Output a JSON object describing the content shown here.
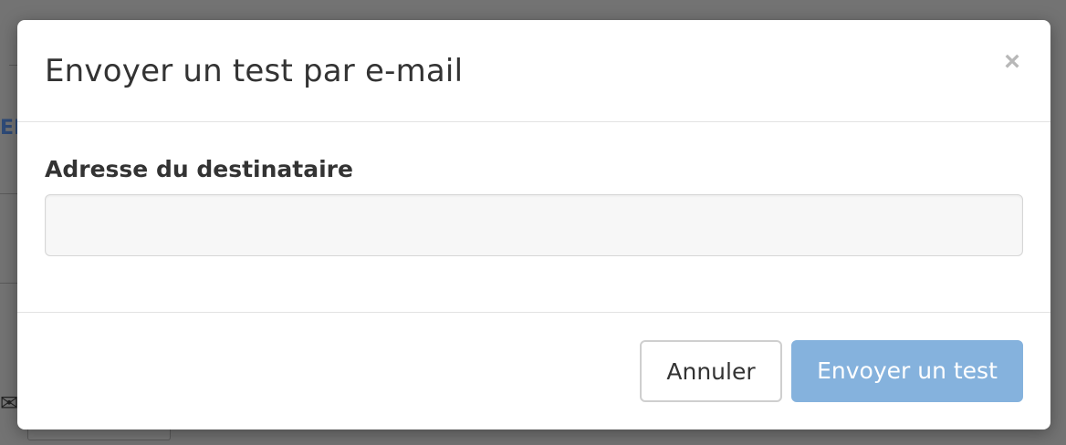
{
  "background": {
    "fragment_text": "EN",
    "envelope_icon": "envelope-icon"
  },
  "modal": {
    "title": "Envoyer un test par e-mail",
    "close_symbol": "×",
    "close_icon": "close-icon",
    "field": {
      "label": "Adresse du destinataire",
      "value": "",
      "placeholder": ""
    },
    "buttons": {
      "cancel_label": "Annuler",
      "send_label": "Envoyer un test"
    }
  },
  "colors": {
    "primary_disabled": "#85b2dd",
    "overlay": "#737373",
    "text": "#333333"
  }
}
